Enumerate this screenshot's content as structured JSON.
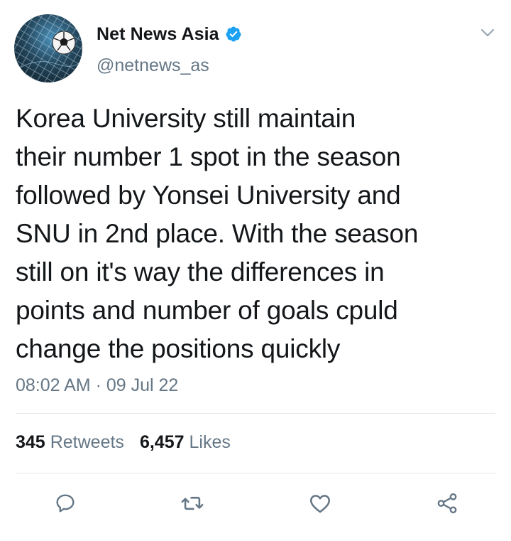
{
  "account": {
    "display_name": "Net News Asia",
    "handle": "@netnews_as",
    "verified": true,
    "avatar_icon": "soccer-ball-in-net"
  },
  "tweet": {
    "text": "Korea University still maintain\ntheir number 1 spot in the season\nfollowed by Yonsei University and\nSNU in 2nd place. With the season\nstill on it's way the differences in\npoints and number of goals cpuld\nchange the positions quickly",
    "timestamp": "08:02 AM · 09 Jul 22"
  },
  "stats": {
    "retweets_count": "345",
    "retweets_label": "Retweets",
    "likes_count": "6,457",
    "likes_label": "Likes"
  },
  "actions": [
    "reply-icon",
    "retweet-icon",
    "like-icon",
    "share-icon"
  ],
  "colors": {
    "text_primary": "#14171a",
    "text_secondary": "#657786",
    "verified_blue": "#1da1f2",
    "divider": "#e1e8ed",
    "icon_gray": "#657786"
  }
}
